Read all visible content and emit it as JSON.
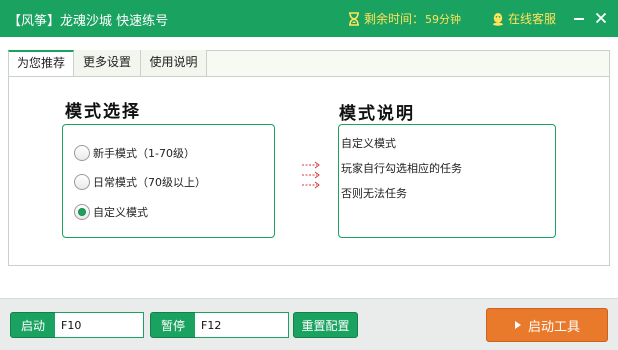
{
  "window": {
    "title": "【风筝】龙魂沙城  快速练号",
    "timer_label": "剩余时间：",
    "timer_value": "59分钟",
    "service_label": "在线客服",
    "icons": [
      "hourglass-icon",
      "qq-penguin-icon",
      "minimize-icon",
      "close-icon"
    ]
  },
  "tabs": [
    {
      "label": "为您推荐",
      "active": true
    },
    {
      "label": "更多设置",
      "active": false
    },
    {
      "label": "使用说明",
      "active": false
    }
  ],
  "mode_section": {
    "title": "模式选择",
    "options": [
      {
        "label": "新手模式（1-70级）",
        "selected": false
      },
      {
        "label": "日常模式（70级以上）",
        "selected": false
      },
      {
        "label": "自定义模式",
        "selected": true
      }
    ]
  },
  "desc_section": {
    "title": "模式说明",
    "lines": [
      "自定义模式",
      "玩家自行勾选相应的任务",
      "否则无法任务"
    ]
  },
  "bottom": {
    "start_label": "启动",
    "start_key": "F10",
    "pause_label": "暂停",
    "pause_key": "F12",
    "reset_label": "重置配置",
    "launch_label": "启动工具"
  },
  "colors": {
    "accent": "#1aa260",
    "timer_text": "#ffe35a",
    "launch_button": "#e9792b",
    "arrow": "#d33b3b"
  }
}
